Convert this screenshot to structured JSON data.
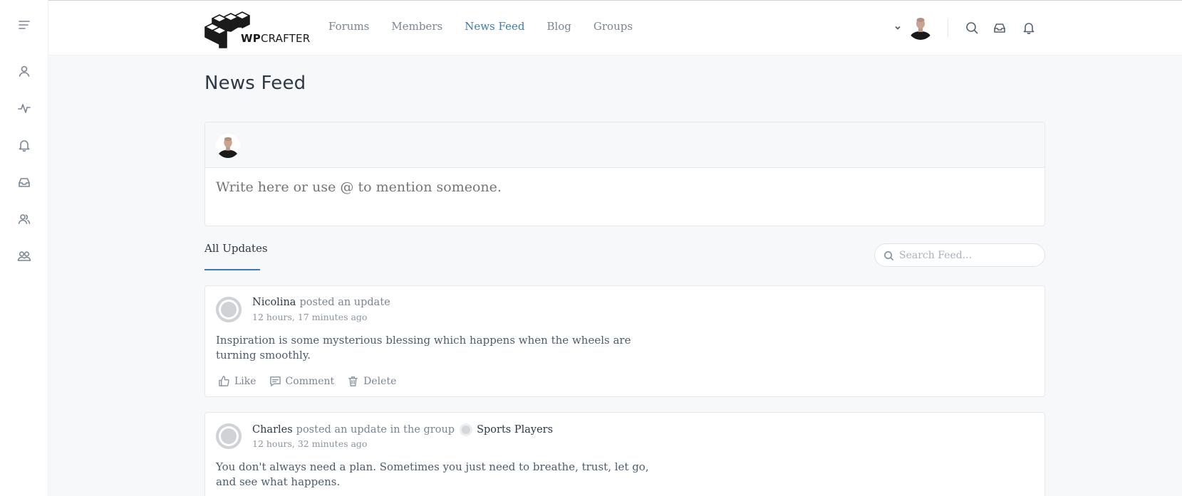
{
  "brand": {
    "logo_bold": "WP",
    "logo_rest": "CRAFTER"
  },
  "nav": {
    "forums": "Forums",
    "members": "Members",
    "news_feed": "News Feed",
    "blog": "Blog",
    "groups": "Groups",
    "active": "News Feed"
  },
  "sidebar": {
    "icons": [
      "menu-icon",
      "profile-icon",
      "activity-icon",
      "notifications-icon",
      "inbox-icon",
      "members-icon",
      "groups-icon"
    ]
  },
  "header_icons": [
    "chevron-down-icon",
    "search-icon",
    "inbox-icon",
    "bell-icon"
  ],
  "page": {
    "title": "News Feed"
  },
  "composer": {
    "placeholder": "Write here or use @ to mention someone."
  },
  "feed": {
    "tab": "All Updates",
    "search_placeholder": "Search Feed..."
  },
  "posts": [
    {
      "author": "Nicolina",
      "action": "posted an update",
      "time": "12 hours, 17 minutes ago",
      "body": "Inspiration is some mysterious blessing which happens when the wheels are turning smoothly.",
      "actions": {
        "like": "Like",
        "comment": "Comment",
        "delete": "Delete"
      }
    },
    {
      "author": "Charles",
      "action": "posted an update in the group",
      "group": "Sports Players",
      "time": "12 hours, 32 minutes ago",
      "body": "You don't always need a plan. Sometimes you just need to breathe, trust, let go, and see what happens."
    }
  ],
  "colors": {
    "accent": "#3f7bb0",
    "background": "#f7f8fa",
    "text": "#4d5c6d",
    "heading": "#2d3947"
  }
}
